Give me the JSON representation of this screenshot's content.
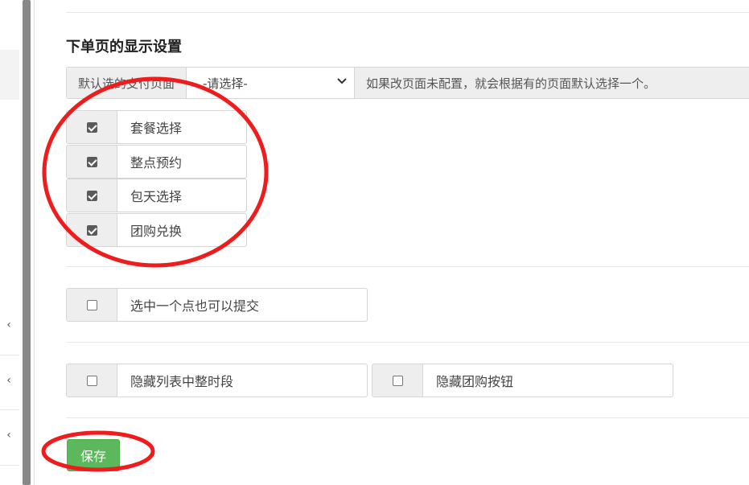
{
  "section_title": "下单页的显示设置",
  "pay_page": {
    "label": "默认选的支付页面",
    "select_value": "-请选择-",
    "help_text": "如果改页面未配置，就会根据有的页面默认选择一个。"
  },
  "options": [
    {
      "label": "套餐选择",
      "checked": true
    },
    {
      "label": "整点预约",
      "checked": true
    },
    {
      "label": "包天选择",
      "checked": true
    },
    {
      "label": "团购兑换",
      "checked": true
    }
  ],
  "single_point": {
    "label": "选中一个点也可以提交",
    "checked": false
  },
  "hide_options": [
    {
      "label": "隐藏列表中整时段",
      "checked": false
    },
    {
      "label": "隐藏团购按钮",
      "checked": false
    }
  ],
  "save_label": "保存",
  "annotation_color": "#ee1c1c"
}
